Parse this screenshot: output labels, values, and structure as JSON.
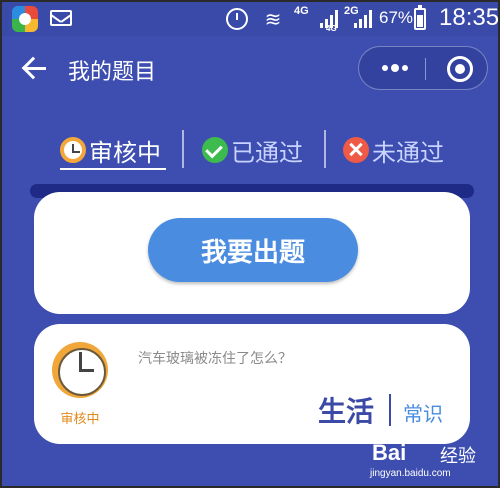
{
  "status_bar": {
    "network_labels": [
      "4G",
      "4G",
      "2G"
    ],
    "battery_percent": "67%",
    "time": "18:35"
  },
  "header": {
    "title": "我的题目"
  },
  "tabs": [
    {
      "label": "审核中",
      "active": true,
      "icon": "clock-icon"
    },
    {
      "label": "已通过",
      "active": false,
      "icon": "check-icon"
    },
    {
      "label": "未通过",
      "active": false,
      "icon": "cross-icon"
    }
  ],
  "create_card": {
    "button_label": "我要出题"
  },
  "question_card": {
    "status_label": "审核中",
    "status_icon": "clock-icon",
    "question": "汽车玻璃被冻住了怎么？",
    "category_main": "生活",
    "category_sub": "常识"
  },
  "watermark": {
    "logo": "Bai",
    "brand": "经验",
    "url": "jingyan.baidu.com"
  },
  "colors": {
    "background": "#3d4eb0",
    "accent_blue": "#4a8ce0",
    "pending_orange": "#f1a63a",
    "passed_green": "#3dbb4e",
    "failed_red": "#ef5a46"
  }
}
